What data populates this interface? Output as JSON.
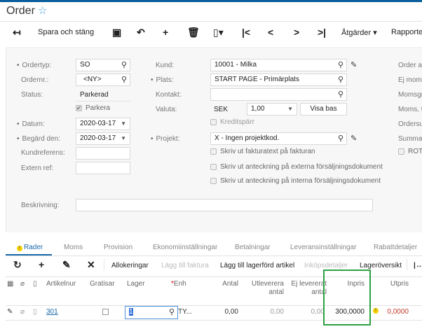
{
  "header": {
    "title": "Order"
  },
  "toolbar": {
    "save_close": "Spara och stäng",
    "actions": "Åtgärder",
    "reports": "Rapporter"
  },
  "form": {
    "ordertyp_label": "Ordertyp:",
    "ordertyp": "SO",
    "ordernr_label": "Ordernr.:",
    "ordernr": "<NY>",
    "status_label": "Status:",
    "status": "Parkerad",
    "parkera_label": "Parkera",
    "datum_label": "Datum:",
    "datum": "2020-03-17",
    "begard_label": "Begärd den:",
    "begard": "2020-03-17",
    "kundref_label": "Kundreferens:",
    "kundref": "",
    "extref_label": "Extern ref:",
    "extref": "",
    "kund_label": "Kund:",
    "kund": "10001 - Milka",
    "plats_label": "Plats:",
    "plats": "START PAGE - Primärplats",
    "kontakt_label": "Kontakt:",
    "kontakt": "",
    "valuta_label": "Valuta:",
    "valuta": "SEK",
    "kurs": "1,00",
    "visa_bas": "Visa bas",
    "kreditsparr": "Kreditspärr",
    "projekt_label": "Projekt:",
    "projekt": "X - Ingen projektkod.",
    "cb1": "Skriv ut fakturatext på fakturan",
    "cb2": "Skriv ut anteckning på externa försäljningsdokument",
    "cb3": "Skriv ut anteckning på interna försäljningsdokument",
    "beskrivning_label": "Beskrivning:",
    "beskrivning": "",
    "right_labels": [
      "Order ar",
      "Ej moms",
      "Momsgr",
      "Moms, t",
      "Ordersu",
      "Summa"
    ],
    "rot": "ROT-"
  },
  "tabs": [
    "Rader",
    "Moms",
    "Provision",
    "Ekonomiinställningar",
    "Betalningar",
    "Leveransinställningar",
    "Rabattdetaljer"
  ],
  "grid_toolbar": {
    "alloc": "Allokeringar",
    "add_invoice": "Lägg till faktura",
    "add_item": "Lägg till lagerförd artikel",
    "purchase": "Inköpsdetaljer",
    "stock": "Lageröversikt"
  },
  "columns": {
    "artikel": "Artikelnur",
    "gratisar": "Gratisar",
    "lager": "Lager",
    "enh": "Enh",
    "antal": "Antal",
    "utlev": "Utleverera antal",
    "ejlev": "Ej levererat antal",
    "inpris": "Inpris",
    "utpris": "Utpris"
  },
  "row": {
    "artikel": "301",
    "lager": "1",
    "enh": "TY...",
    "antal": "0,00",
    "utlev": "0,00",
    "ejlev": "0,00",
    "inpris": "300,0000",
    "utpris": "0,0000"
  },
  "colors": {
    "accent": "#0a5e9c",
    "highlight": "#2ea043",
    "error": "#c0392b"
  }
}
